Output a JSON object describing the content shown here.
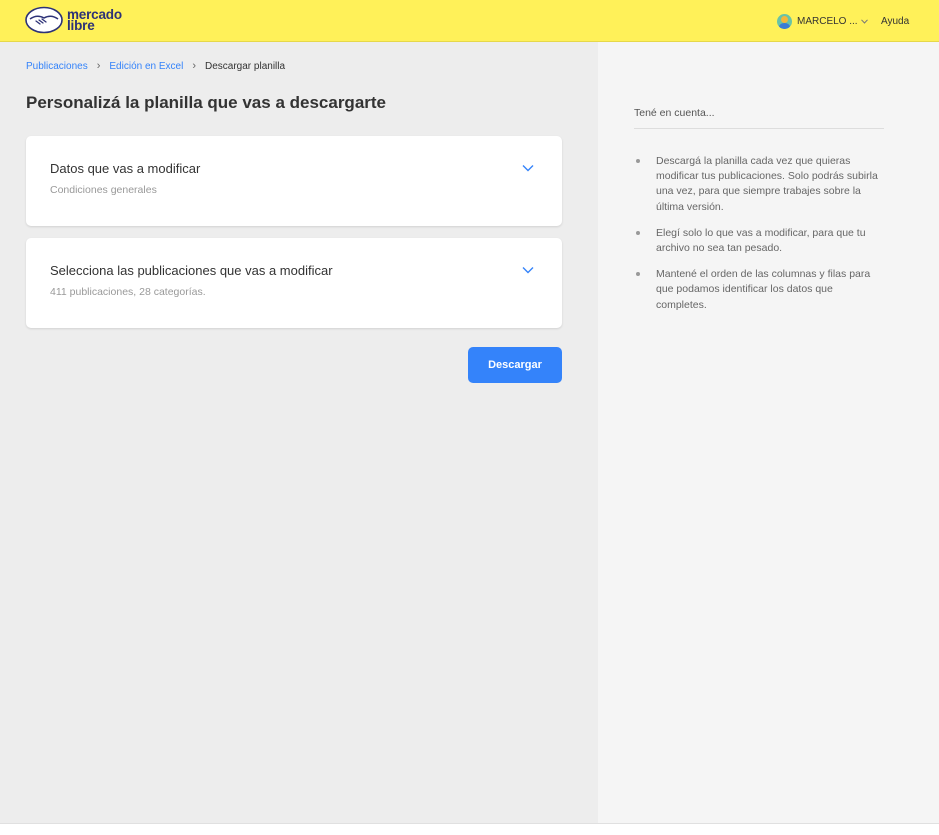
{
  "header": {
    "logo_line1": "mercado",
    "logo_line2": "libre",
    "user_name": "MARCELO ...",
    "help_label": "Ayuda"
  },
  "breadcrumb": {
    "items": [
      "Publicaciones",
      "Edición en Excel"
    ],
    "current": "Descargar planilla"
  },
  "page_title": "Personalizá la planilla que vas a descargarte",
  "cards": [
    {
      "title": "Datos que vas a modificar",
      "subtitle": "Condiciones generales"
    },
    {
      "title": "Selecciona las publicaciones que vas a modificar",
      "subtitle": "411 publicaciones, 28 categorías."
    }
  ],
  "download_label": "Descargar",
  "aside": {
    "title": "Tené en cuenta...",
    "tips": [
      "Descargá la planilla cada vez que quieras modificar tus publicaciones. Solo podrás subirla una vez, para que siempre trabajes sobre la última versión.",
      "Elegí solo lo que vas a modificar, para que tu archivo no sea tan pesado.",
      "Mantené el orden de las columnas y filas para que podamos identificar los datos que completes."
    ]
  },
  "colors": {
    "header_bg": "#fff159",
    "accent": "#3483fa",
    "logo_text": "#2d3277"
  }
}
